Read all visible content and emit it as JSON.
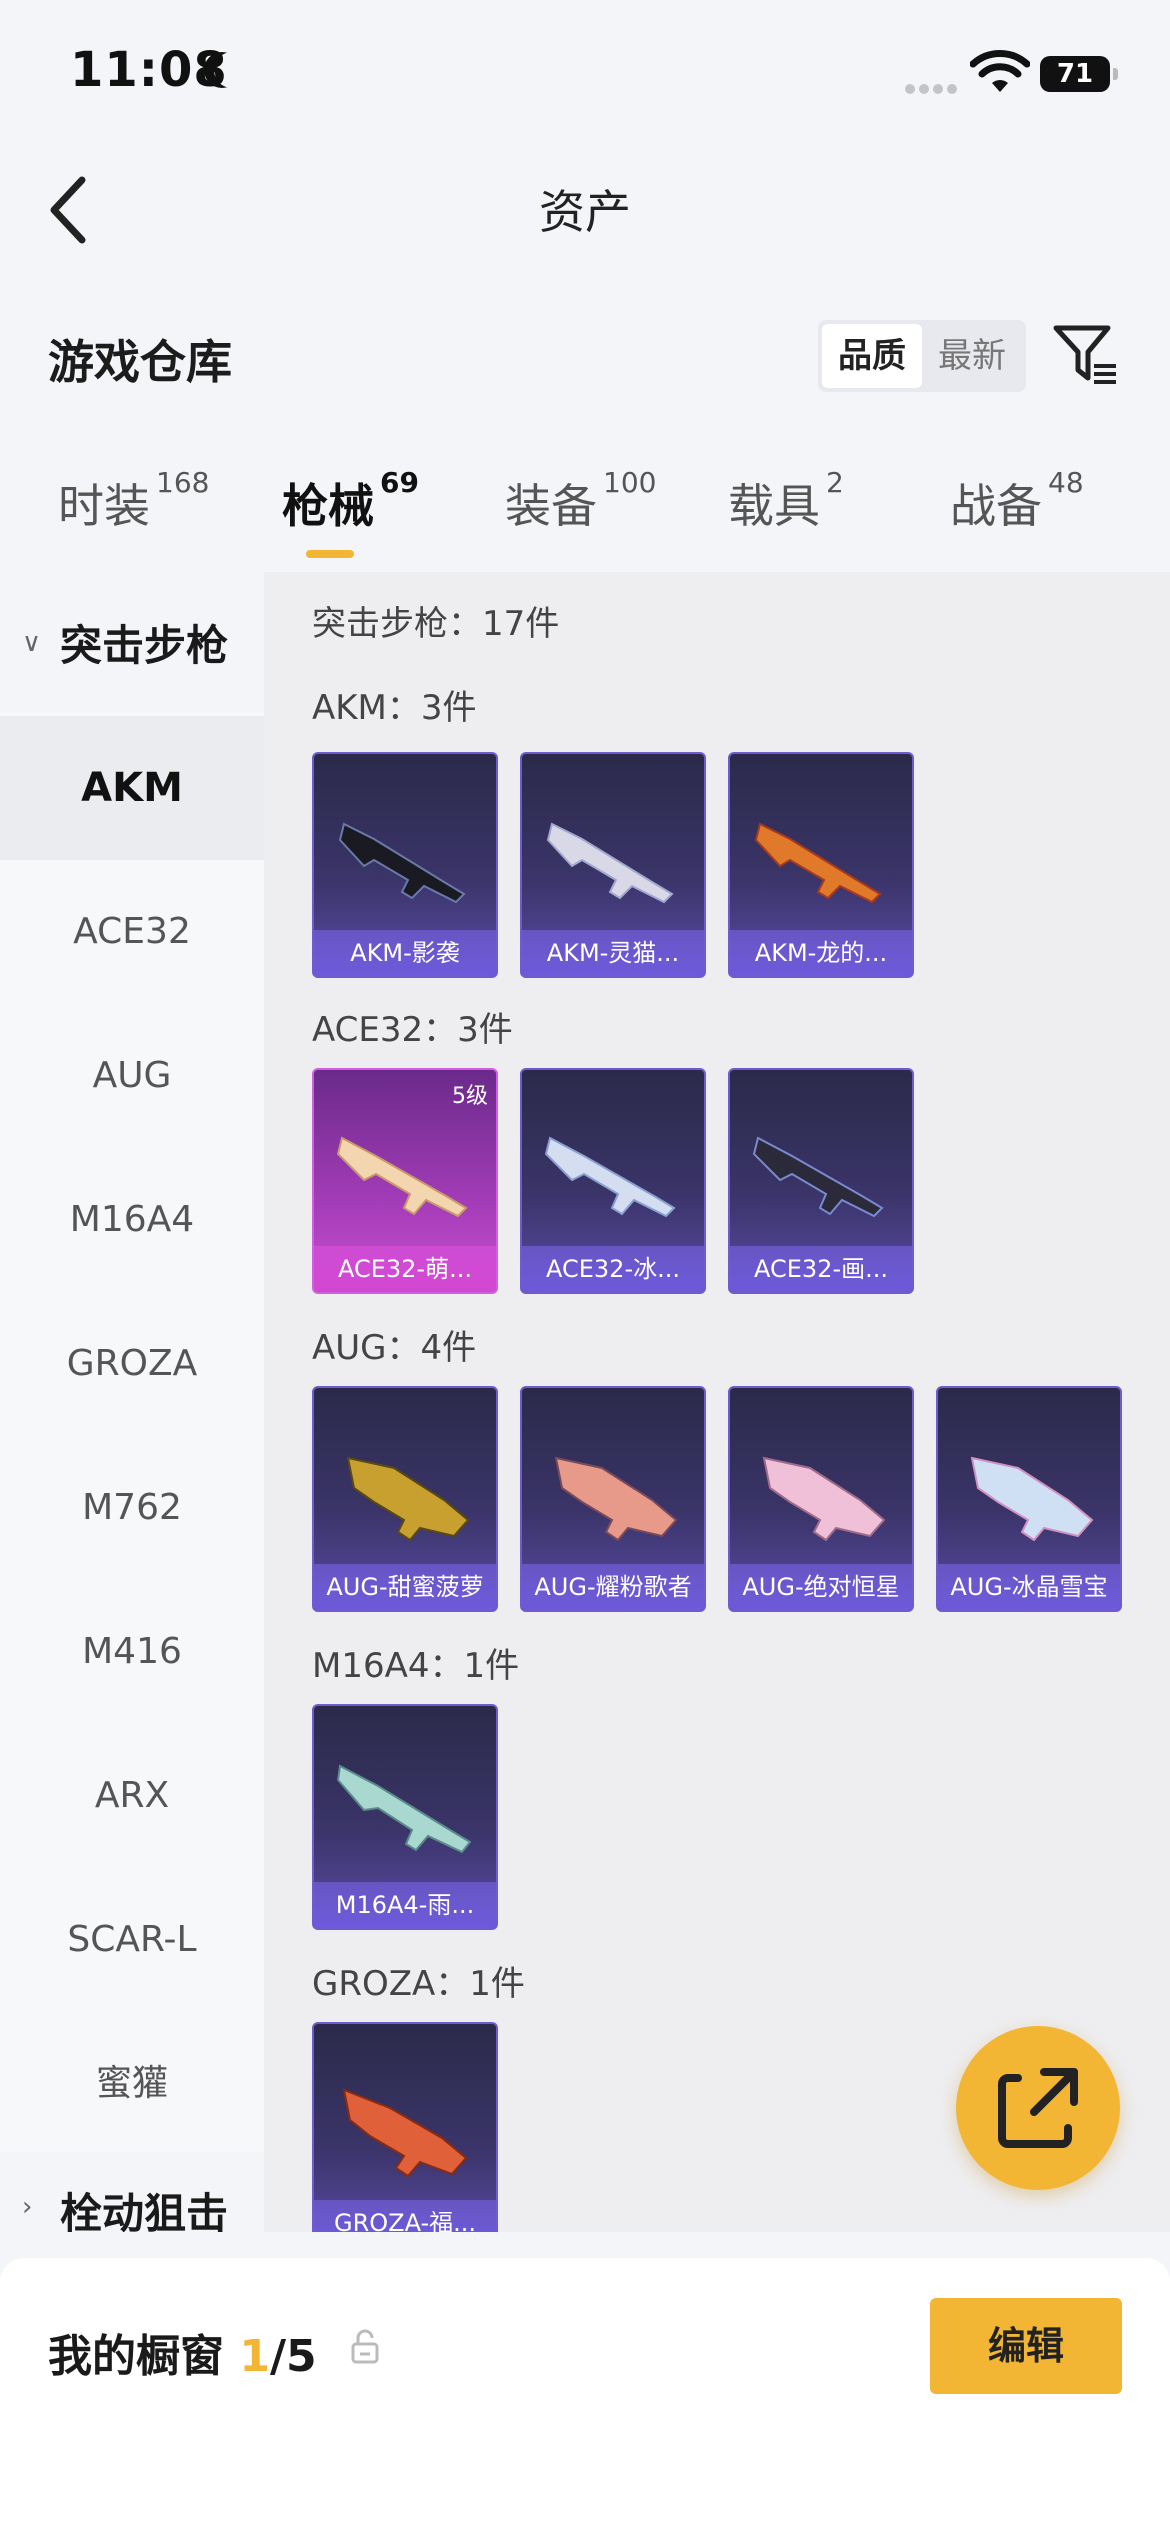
{
  "status": {
    "time": "11:08",
    "battery": "71"
  },
  "nav": {
    "title": "资产"
  },
  "warehouse": {
    "title": "游戏仓库"
  },
  "sort": {
    "options": [
      "品质",
      "最新"
    ],
    "selected": "品质"
  },
  "tabs": [
    {
      "label": "时装",
      "count": "168"
    },
    {
      "label": "枪械",
      "count": "69",
      "active": true
    },
    {
      "label": "装备",
      "count": "100"
    },
    {
      "label": "载具",
      "count": "2"
    },
    {
      "label": "战备",
      "count": "48"
    }
  ],
  "sidebar": {
    "group_open": "突击步枪",
    "items": [
      "AKM",
      "ACE32",
      "AUG",
      "M16A4",
      "GROZA",
      "M762",
      "M416",
      "ARX",
      "SCAR-L",
      "蜜獾"
    ],
    "group_next": "栓动狙击"
  },
  "content": {
    "category_summary": "突击步枪：17件",
    "sections": [
      {
        "title": "AKM：3件",
        "items": [
          {
            "name": "AKM-影袭"
          },
          {
            "name": "AKM-灵猫..."
          },
          {
            "name": "AKM-龙的..."
          }
        ]
      },
      {
        "title": "ACE32：3件",
        "items": [
          {
            "name": "ACE32-萌...",
            "level": "5级"
          },
          {
            "name": "ACE32-冰..."
          },
          {
            "name": "ACE32-画..."
          }
        ]
      },
      {
        "title": "AUG：4件",
        "items": [
          {
            "name": "AUG-甜蜜菠萝"
          },
          {
            "name": "AUG-耀粉歌者"
          },
          {
            "name": "AUG-绝对恒星"
          },
          {
            "name": "AUG-冰晶雪宝"
          }
        ]
      },
      {
        "title": "M16A4：1件",
        "items": [
          {
            "name": "M16A4-雨..."
          }
        ]
      },
      {
        "title": "GROZA：1件",
        "items": [
          {
            "name": "GROZA-福..."
          }
        ]
      }
    ]
  },
  "bottom": {
    "label": "我的橱窗",
    "current": "1",
    "total": "/5",
    "edit": "编辑"
  },
  "colors": {
    "accent": "#f2b534",
    "card_purple": "#5a4aa6",
    "card_pink": "#c850d0"
  }
}
